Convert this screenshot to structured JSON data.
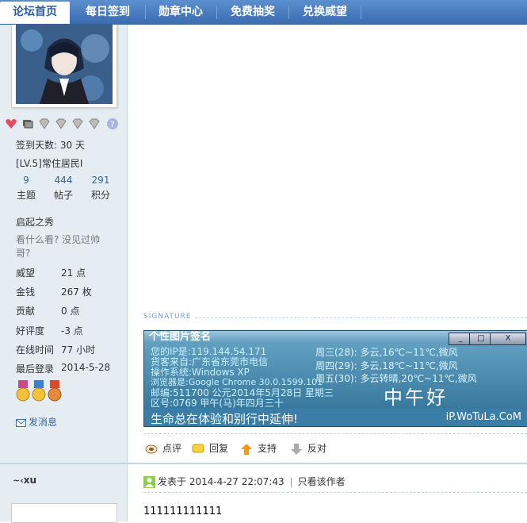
{
  "nav": {
    "items": [
      {
        "label": "论坛首页",
        "active": true
      },
      {
        "label": "每日签到",
        "active": false
      },
      {
        "label": "勋章中心",
        "active": false
      },
      {
        "label": "免费抽奖",
        "active": false
      },
      {
        "label": "兑换威望",
        "active": false
      }
    ]
  },
  "user": {
    "checkin": "签到天数: 30 天",
    "level": "[LV.5]常住居民I",
    "stats": [
      {
        "num": "9",
        "label": "主题"
      },
      {
        "num": "444",
        "label": "帖子"
      },
      {
        "num": "291",
        "label": "积分"
      }
    ],
    "title": "启起之秀",
    "sightml": "看什么看? 没见过帅哥?",
    "props": [
      {
        "label": "威望",
        "value": "21 点"
      },
      {
        "label": "金钱",
        "value": "267 枚"
      },
      {
        "label": "贡献",
        "value": "0 点"
      },
      {
        "label": "好评度",
        "value": "-3 点"
      },
      {
        "label": "在线时间",
        "value": "77 小时"
      },
      {
        "label": "最后登录",
        "value": "2014-5-28"
      }
    ],
    "message_link": "发消息"
  },
  "signature": {
    "heading": "SIGNATURE",
    "card_title": "个性图片签名",
    "win_buttons": [
      "_",
      "□",
      "X"
    ],
    "lines": [
      "您的IP是:119.144.54.171",
      "货客来自:广东省东莞市电信",
      "操作系统:Windows XP",
      "浏览器是:Google Chrome 30.0.1599.101",
      "邮编:511700  公元2014年5月28日 星期三",
      "区号:0769      甲午(马)年四月三十"
    ],
    "weather": [
      "周三(28): 多云,16℃~11℃,微风",
      "周四(29): 多云,18℃~11℃,微风",
      "周五(30): 多云转晴,20℃~11℃,微风"
    ],
    "greeting": "中午好",
    "footer_left": "生命总在体验和别行中延伸!",
    "footer_right": "iP.WoTuLa.CoM"
  },
  "actions": {
    "rate": "点评",
    "reply": "回复",
    "support": "支持",
    "oppose": "反对"
  },
  "next_post": {
    "author": "xu",
    "posted_label": "发表于 2014-4-27 22:07:43",
    "only_author": "只看该作者",
    "body": "111111111111"
  },
  "colors": {
    "nav_bg": "#3a6db1",
    "sidebar_bg": "#e5edf2",
    "link": "#336699"
  }
}
